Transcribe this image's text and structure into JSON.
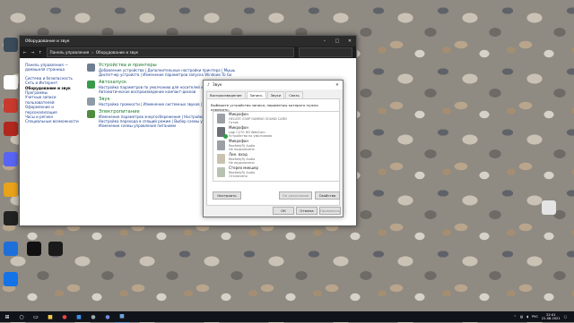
{
  "window": {
    "title": "Оборудование и звук",
    "breadcrumb": [
      "Панель управления",
      "Оборудование и звук"
    ],
    "nav": [
      "Панель управления —",
      "домашняя страница",
      "Система и безопасность",
      "Сеть и Интернет",
      "Оборудование и звук",
      "Программы",
      "Учетные записи",
      "пользователей",
      "Оформление и",
      "персонализация",
      "Часы и регион",
      "Специальные возможности"
    ],
    "categories": [
      {
        "title": "Устройства и принтеры",
        "links": [
          "Добавление устройства  |  Дополнительные настройки принтера  |  Мышь",
          "Диспетчер устройств  |  Изменение параметров запуска Windows To Go"
        ]
      },
      {
        "title": "Автозапуск",
        "links": [
          "Настройка параметров по умолчанию для носителей или устройств",
          "Автоматическое воспроизведение компакт-дисков"
        ]
      },
      {
        "title": "Звук",
        "links": [
          "Настройка громкости  |  Изменение системных звуков  |  Управление звуковыми устройствами"
        ]
      },
      {
        "title": "Электропитание",
        "links": [
          "Изменение параметров энергосбережения  |  Настройка функций кнопок питания",
          "Настройка перехода в спящий режим  |  Выбор схемы управления питанием",
          "Изменение схемы управления питанием"
        ]
      }
    ]
  },
  "dialog": {
    "title": "Звук",
    "close": "✕",
    "tabs": [
      "Воспроизведение",
      "Запись",
      "Звуки",
      "Связь"
    ],
    "hint": "Выберите устройство записи, параметры которого нужно изменить:",
    "devices": [
      {
        "name": "Микрофон",
        "detail": "HECATE G30P GAMING SOUND CARD",
        "status": "Готов"
      },
      {
        "name": "Микрофон",
        "detail": "Logi C270 HD WebCam",
        "status": "Устройство по умолчанию"
      },
      {
        "name": "Микрофон",
        "detail": "Realtek(R) Audio",
        "status": "Не подключено"
      },
      {
        "name": "Лин. вход",
        "detail": "Realtek(R) Audio",
        "status": "Не подключено"
      },
      {
        "name": "Стерео микшер",
        "detail": "Realtek(R) Audio",
        "status": "Отключено"
      }
    ],
    "buttons": {
      "configure": "Настроить",
      "default": "По умолчанию",
      "properties": "Свойства",
      "ok": "ОК",
      "cancel": "Отмена",
      "apply": "Применить"
    }
  },
  "taskbar": {
    "lang": "РУС",
    "time": "22:41",
    "date": "21.08.2021"
  }
}
